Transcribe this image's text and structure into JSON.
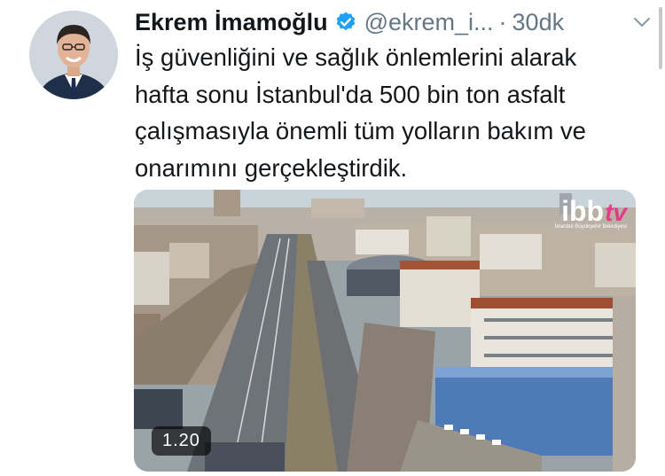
{
  "tweet": {
    "author_name": "Ekrem İmamoğlu",
    "handle": "@ekrem_i...",
    "separator": "·",
    "time": "30dk",
    "text": "İş güvenliğini ve sağlık önlemlerini alarak\nhafta sonu İstanbul'da 500 bin ton asfalt\nçalışmasıyla önemli tüm yolların bakım ve\nonarımını gerçekleştirdik.",
    "verified": true
  },
  "media": {
    "type": "video",
    "duration": "1.20",
    "logo_main": "ibb",
    "logo_accent": "tv",
    "logo_subtitle": "İstanbul Büyükşehir Belediyesi"
  },
  "icons": {
    "verified": "verified-badge-icon",
    "menu": "chevron-down-icon"
  },
  "colors": {
    "text": "#14171a",
    "secondary": "#657786",
    "verified": "#1da1f2",
    "logo_accent": "#e63a8a"
  }
}
